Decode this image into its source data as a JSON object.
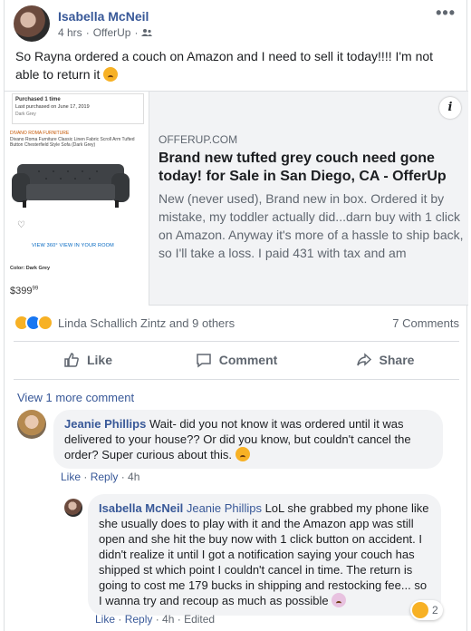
{
  "post": {
    "author": "Isabella McNeil",
    "time": "4 hrs",
    "source": "OfferUp",
    "text": "So Rayna ordered a couch on Amazon and I need to sell it today!!!! I'm not able to return it",
    "link": {
      "domain": "OFFERUP.COM",
      "title": "Brand new tufted grey couch need gone today! for Sale in San Diego, CA - OfferUp",
      "description": "New (never used), Brand new in box. Ordered it by mistake, my toddler actually did...darn buy with 1 click on Amazon. Anyway it's more of a hassle to ship back, so I'll take a loss. I paid 431 with tax and am",
      "thumb": {
        "purchased": "Purchased 1 time",
        "last_purchased": "Last purchased on June 17, 2019",
        "variant": "Dark Grey",
        "brand": "DIVANO ROMA FURNITURE",
        "product": "Divano Roma Furniture Classic Linen Fabric Scroll Arm Tufted Button Chesterfield Style Sofa (Dark Grey)",
        "views": "VIEW 360°    VIEW IN YOUR ROOM",
        "color_label": "Color: Dark Grey",
        "price": "$399",
        "price_cents": "99"
      }
    }
  },
  "reactions": {
    "names": "Linda Schallich Zintz and 9 others",
    "comments_count": "7 Comments",
    "colors": [
      "#f7b125",
      "#1877f2",
      "#f7b125"
    ]
  },
  "actions": {
    "like": "Like",
    "comment": "Comment",
    "share": "Share"
  },
  "comments": {
    "view_more": "View 1 more comment",
    "c1": {
      "name": "Jeanie Phillips",
      "text": "Wait- did you not know it was ordered until it was delivered to your house?? Or did you know, but couldn't cancel the order? Super curious about this.",
      "like": "Like",
      "reply": "Reply",
      "time": "4h"
    },
    "c2": {
      "name": "Isabella McNeil",
      "tag": "Jeanie Phillips",
      "text": "LoL she grabbed my phone like she usually does to play with it and the Amazon app was still open and she hit the buy now with 1 click button on accident. I didn't realize it until I got a notification saying your couch has shipped st which point I couldn't cancel in time. The return is going to cost me 179 bucks in shipping and restocking fee... so I wanna try and recoup as much as possible",
      "like": "Like",
      "reply": "Reply",
      "time": "4h",
      "edited": "Edited",
      "reaction_count": "2"
    }
  }
}
